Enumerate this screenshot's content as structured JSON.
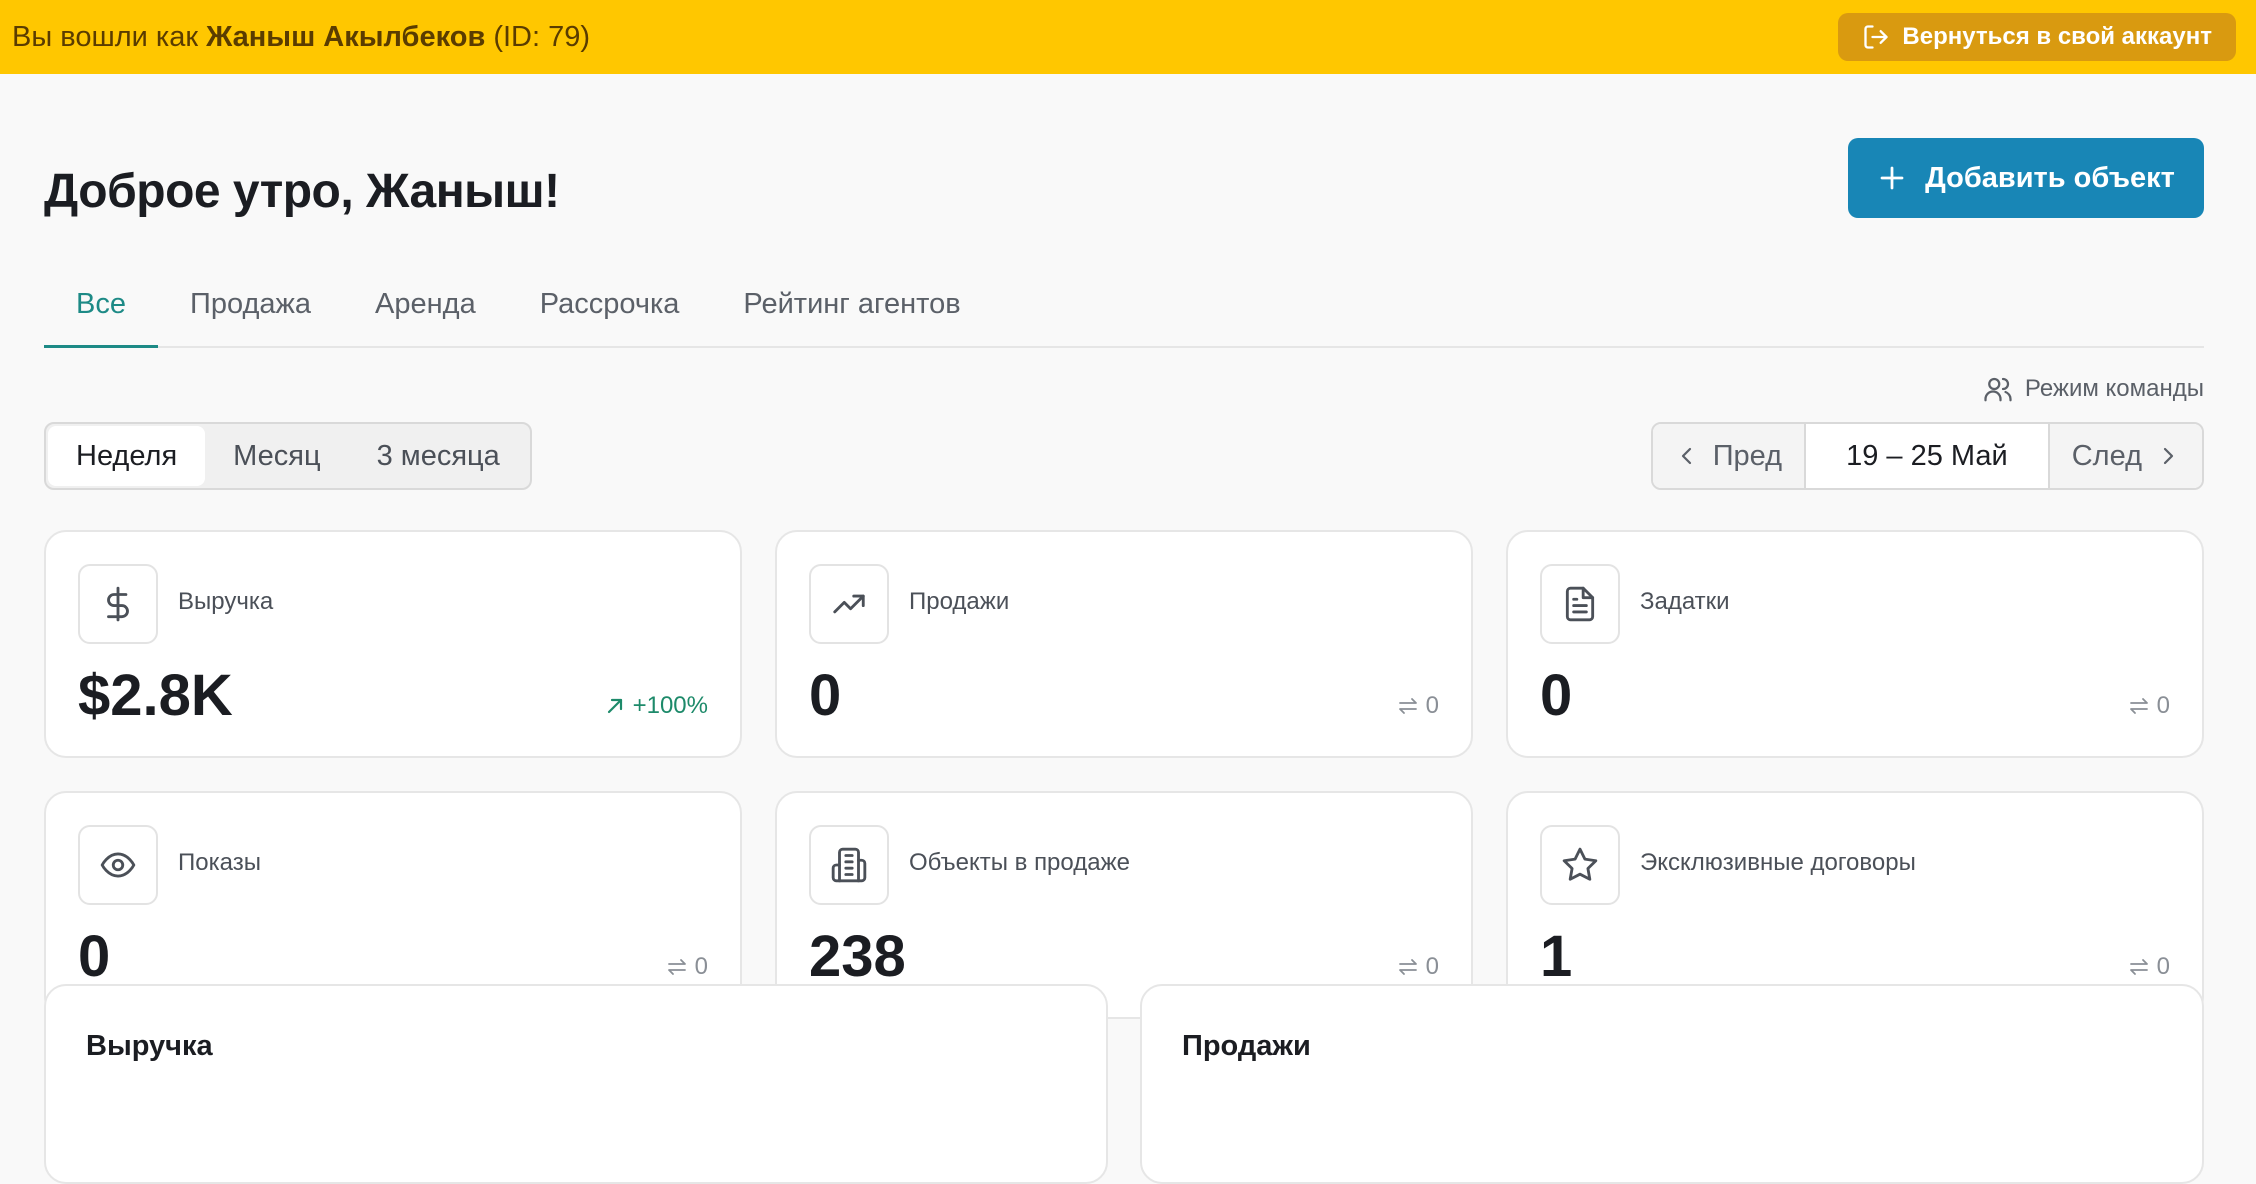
{
  "banner": {
    "prefix": "Вы вошли как ",
    "user_name": "Жаныш Акылбеков",
    "user_id": " (ID: 79)",
    "return_button": "Вернуться в свой аккаунт"
  },
  "header": {
    "title": "Доброе утро, Жаныш!",
    "add_button": "Добавить объект"
  },
  "tabs": [
    {
      "label": "Все",
      "active": true
    },
    {
      "label": "Продажа",
      "active": false
    },
    {
      "label": "Аренда",
      "active": false
    },
    {
      "label": "Рассрочка",
      "active": false
    },
    {
      "label": "Рейтинг агентов",
      "active": false
    }
  ],
  "team_mode": "Режим команды",
  "period": {
    "options": [
      "Неделя",
      "Месяц",
      "3 месяца"
    ],
    "selected": "Неделя"
  },
  "pager": {
    "prev": "Пред",
    "range": "19 – 25 Май",
    "next": "След"
  },
  "cards": [
    {
      "icon": "dollar-icon",
      "label": "Выручка",
      "value": "$2.8K",
      "delta": "+100%",
      "trend": "up"
    },
    {
      "icon": "trending-up-icon",
      "label": "Продажи",
      "value": "0",
      "delta": "0",
      "trend": "flat"
    },
    {
      "icon": "document-icon",
      "label": "Задатки",
      "value": "0",
      "delta": "0",
      "trend": "flat"
    },
    {
      "icon": "eye-icon",
      "label": "Показы",
      "value": "0",
      "delta": "0",
      "trend": "flat"
    },
    {
      "icon": "building-icon",
      "label": "Объекты в продаже",
      "value": "238",
      "delta": "0",
      "trend": "flat"
    },
    {
      "icon": "star-icon",
      "label": "Эксклюзивные договоры",
      "value": "1",
      "delta": "0",
      "trend": "flat"
    }
  ],
  "bottom": {
    "left_title": "Выручка",
    "right_title": "Продажи"
  },
  "colors": {
    "banner_bg": "#ffc700",
    "primary": "#1886b6",
    "accent_tab": "#1d8a86",
    "positive": "#1d8a6a"
  }
}
